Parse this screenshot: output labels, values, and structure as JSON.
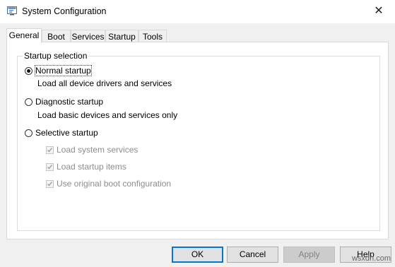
{
  "window": {
    "title": "System Configuration",
    "icon": "msconfig-icon",
    "close_glyph": "✕"
  },
  "tabs": [
    {
      "label": "General",
      "active": true
    },
    {
      "label": "Boot",
      "active": false
    },
    {
      "label": "Services",
      "active": false
    },
    {
      "label": "Startup",
      "active": false
    },
    {
      "label": "Tools",
      "active": false
    }
  ],
  "group": {
    "label": "Startup selection",
    "options": [
      {
        "label": "Normal startup",
        "description": "Load all device drivers and services",
        "selected": true
      },
      {
        "label": "Diagnostic startup",
        "description": "Load basic devices and services only",
        "selected": false
      },
      {
        "label": "Selective startup",
        "selected": false
      }
    ],
    "checkboxes": [
      {
        "label": "Load system services",
        "checked": true,
        "enabled": false
      },
      {
        "label": "Load startup items",
        "checked": true,
        "enabled": false
      },
      {
        "label": "Use original boot configuration",
        "checked": true,
        "enabled": false
      }
    ]
  },
  "buttons": {
    "ok": "OK",
    "cancel": "Cancel",
    "apply": "Apply",
    "help": "Help"
  },
  "watermark": "wsxdn.com"
}
